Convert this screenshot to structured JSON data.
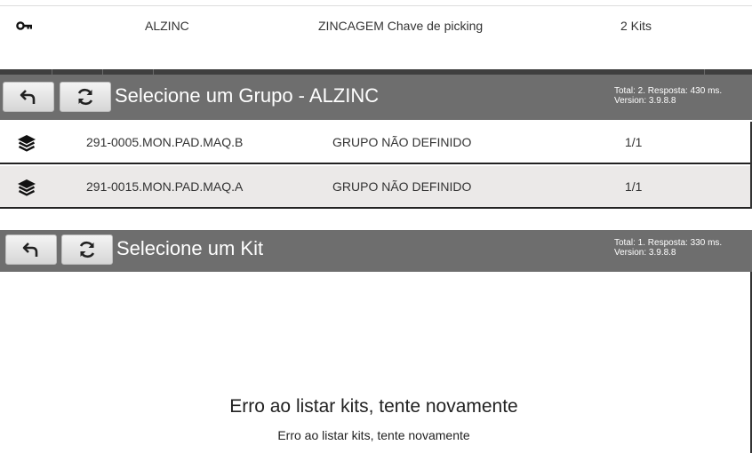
{
  "top_table": {
    "row": {
      "icon": "key-icon",
      "code": "ALZINC",
      "description": "ZINCAGEM Chave de picking",
      "count": "2 Kits"
    }
  },
  "group_panel": {
    "title": "Selecione um Grupo - ALZINC",
    "info_line1": "Total: 2. Resposta: 430 ms.",
    "info_line2": "Version: 3.9.8.8",
    "back_icon": "undo-arrow-icon",
    "refresh_icon": "refresh-icon",
    "rows": [
      {
        "icon": "layers-icon",
        "code": "291-0005.MON.PAD.MAQ.B",
        "group": "GRUPO NÃO DEFINIDO",
        "ratio": "1/1"
      },
      {
        "icon": "layers-icon",
        "code": "291-0015.MON.PAD.MAQ.A",
        "group": "GRUPO NÃO DEFINIDO",
        "ratio": "1/1"
      }
    ]
  },
  "kit_panel": {
    "title": "Selecione um Kit",
    "info_line1": "Total: 1. Resposta: 330 ms.",
    "info_line2": "Version: 3.9.8.8",
    "back_icon": "undo-arrow-icon",
    "refresh_icon": "refresh-icon",
    "error_title": "Erro ao listar kits, tente novamente",
    "error_message": "Erro ao listar kits, tente novamente"
  },
  "colors": {
    "header_bg": "#6e6e6e",
    "row_alt_bg": "#ebe9e8",
    "text": "#333333"
  }
}
